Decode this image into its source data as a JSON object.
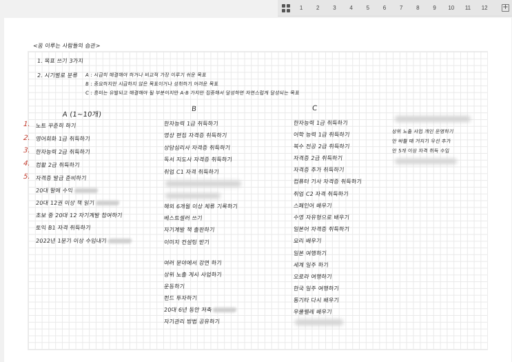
{
  "pager": {
    "icon": "grid-icon",
    "pages": [
      "1",
      "2",
      "3",
      "4",
      "5",
      "6",
      "7",
      "8",
      "9",
      "10",
      "11",
      "12"
    ],
    "add_icon": "plus-icon",
    "add_label": "+"
  },
  "note": {
    "title": "<꿈 이루는 사람들의 습관>",
    "items": [
      "1. 목표 쓰기 3가지",
      "2. 시기별로 분류",
      "A : 시급히 해결해야 하거나 비교적 가장 이루기 쉬운 목표",
      "B : 중요하지만 시급하지 않은 목표이거나 성취하기 어려운 목표",
      "C : 흥미는 유발되고 해결해야 될 부분이지만 A·B 가지만 집중해서 달성하면 자연스럽게 달성되는 목표"
    ],
    "columns": {
      "a_header": "A (1~10개)",
      "b_header": "B",
      "c_header": "C",
      "red_numbers": [
        "1.",
        "2.",
        "3.",
        "4.",
        "5."
      ],
      "a": [
        "노트 꾸준히 하기",
        "영어회화 1급 취득하기",
        "한자능력 2급 취득하기",
        "컴활 2급 취득하기",
        "자격증 발급 준비하기",
        "20대 말에 수익",
        "20대 12권 이상 책 읽기",
        "초보 중 20대 12 자기계발 참여하기",
        "토익 B1 자격 취득하기",
        "2022년 1분기 이상 수입내기"
      ],
      "b": [
        "한자능력 1급 취득하기",
        "영상 편집 자격증 취득하기",
        "상담심리사 자격증 취득하기",
        "독서 지도사 자격증 취득하기",
        "취업 C1 자격 취득하기",
        "해외 6개월 이상 체류 기록하기",
        "베스트셀러 쓰기",
        "자기계발 책 출판하기",
        "이미지 컨설팅 받기",
        "여러 분야에서 강연 하기",
        "상위 노출 게시 사업하기",
        "운동하기",
        "펀드 투자하기",
        "20대 6년 동안 저축",
        "자기관리 방법 공유하기"
      ],
      "c": [
        "한자능력 1급 취득하기",
        "어학 능력 1급 취득하기",
        "복수 전공 2급 취득하기",
        "자격증 2급 취득하기",
        "자격증 추가 취득하기",
        "컴퓨터 기사 자격증 취득하기",
        "취업 C2 자격 취득하기",
        "스페인어 배우기",
        "수영 자유형으로 배우기",
        "일본어 자격증 취득하기",
        "요리 배우기",
        "일본 여행하기",
        "세계 일주 하기",
        "오로라 여행하기",
        "한국 일주 여행하기",
        "통기타 다시 배우기",
        "우쿨렐레 배우기"
      ],
      "d": [
        "상위 노출 사업 개인 운영하기",
        "안 바쁠 때 거치기 우선 추가",
        "안 5개 이상 자격 취득 수입"
      ]
    }
  }
}
